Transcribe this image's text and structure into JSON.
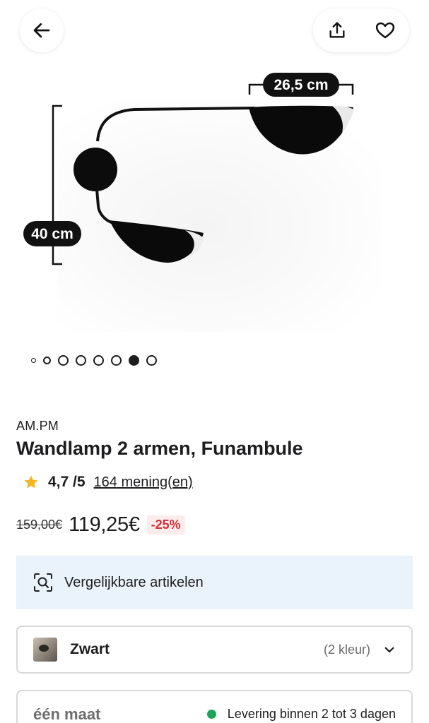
{
  "header": {
    "back_icon": "arrow-left-icon",
    "share_icon": "share-icon",
    "favorite_icon": "heart-icon"
  },
  "gallery": {
    "dimension_width": "26,5 cm",
    "dimension_height": "40 cm",
    "image_count": 8,
    "active_index": 6
  },
  "product": {
    "brand": "AM.PM",
    "title": "Wandlamp 2 armen, Funambule",
    "rating": "4,7 /5",
    "reviews": "164 mening(en)",
    "old_price": "159,00€",
    "price": "119,25€",
    "discount": "-25%"
  },
  "similar": {
    "label": "Vergelijkbare artikelen",
    "icon": "image-search-icon"
  },
  "variant": {
    "color": "Zwart",
    "count": "(2 kleur)",
    "icon": "chevron-down-icon"
  },
  "size": {
    "label": "één maat",
    "delivery": "Levering binnen 2 tot 3 dagen"
  },
  "colors": {
    "accent_blue_bg": "#eaf3fc",
    "discount_red": "#d4303a",
    "delivery_green": "#1fa55a",
    "star_yellow": "#f2b824"
  }
}
